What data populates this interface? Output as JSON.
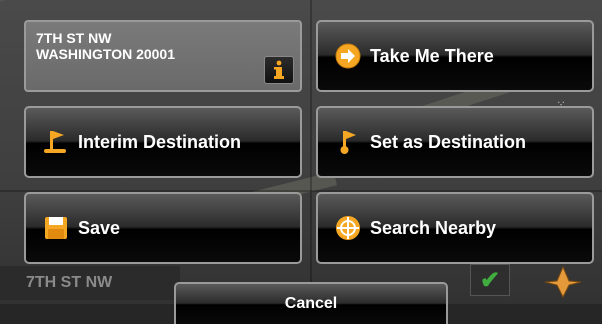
{
  "address": {
    "line1": "7TH ST NW",
    "line2": "WASHINGTON 20001",
    "info_label": "i"
  },
  "buttons": {
    "take_me_there": "Take Me There",
    "interim_destination": "Interim Destination",
    "set_as_destination": "Set as Destination",
    "save": "Save",
    "search_nearby": "Search Nearby",
    "cancel": "Cancel"
  },
  "map": {
    "current_street": "7TH ST NW"
  },
  "colors": {
    "accent_orange": "#f5a623",
    "check_green": "#3fae3f"
  }
}
